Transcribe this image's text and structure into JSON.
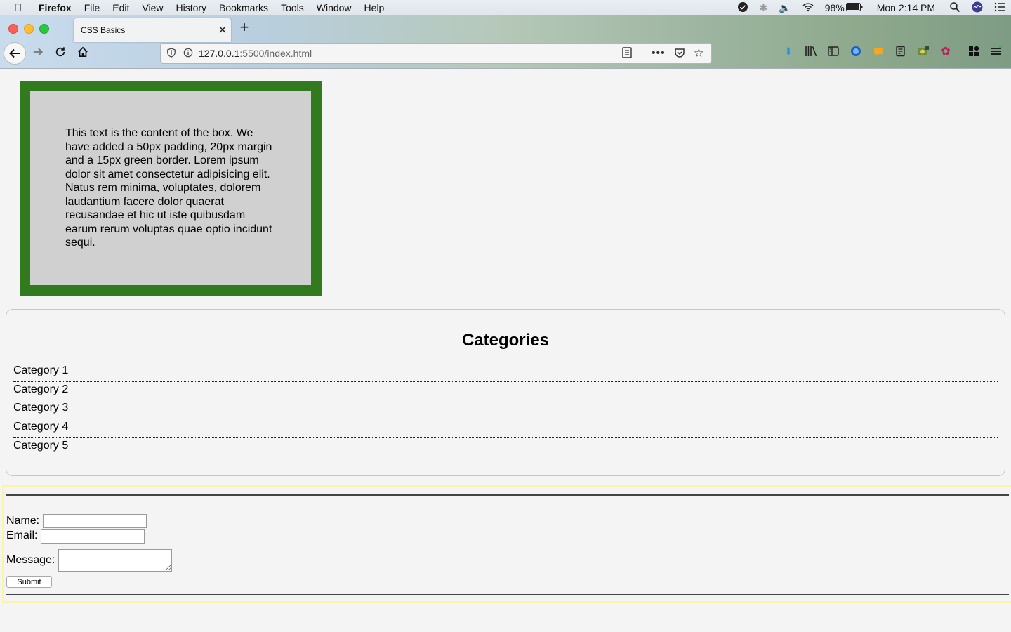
{
  "menubar": {
    "app_name": "Firefox",
    "items": [
      "File",
      "Edit",
      "View",
      "History",
      "Bookmarks",
      "Tools",
      "Window",
      "Help"
    ],
    "battery": "98%",
    "clock": "Mon 2:14 PM"
  },
  "browser": {
    "tab_title": "CSS Basics",
    "url_host": "127.0.0.1",
    "url_rest": ":5500/index.html"
  },
  "content_box": {
    "text": "This text is the content of the box. We have added a 50px padding, 20px margin and a 15px green border. Lorem ipsum dolor sit amet consectetur adipisicing elit. Natus rem minima, voluptates, dolorem laudantium facere dolor quaerat recusandae et hic ut iste quibusdam earum rerum voluptas quae optio incidunt sequi."
  },
  "categories": {
    "title": "Categories",
    "items": [
      "Category 1",
      "Category 2",
      "Category 3",
      "Category 4",
      "Category 5"
    ]
  },
  "form": {
    "name_label": "Name:",
    "email_label": "Email:",
    "message_label": "Message:",
    "submit_label": "Submit",
    "name_value": "",
    "email_value": "",
    "message_value": ""
  },
  "colors": {
    "box_border": "#327a1e",
    "box_background": "#d0d0d0",
    "form_border": "#fbf6a6"
  }
}
